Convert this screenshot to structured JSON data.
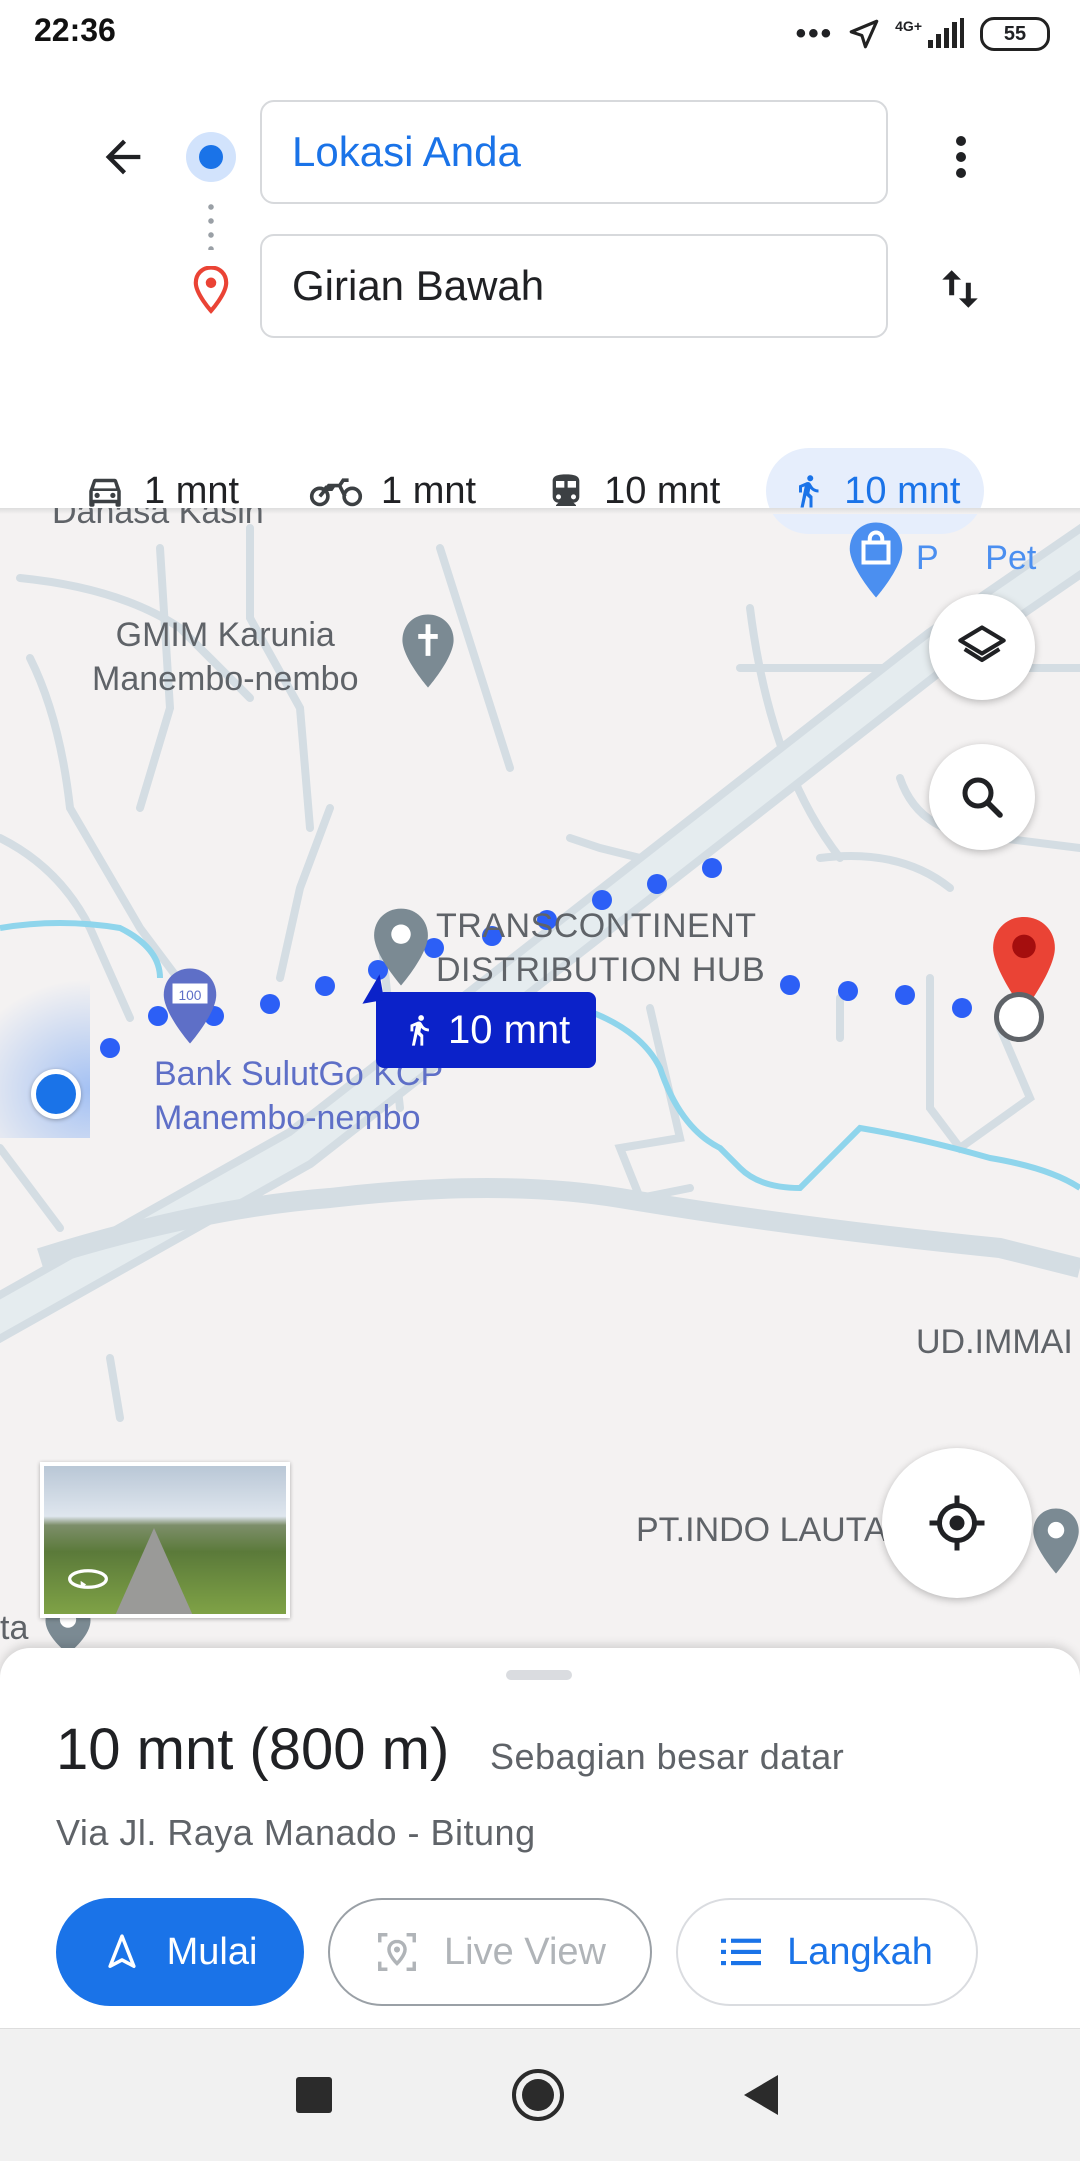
{
  "status_bar": {
    "time": "22:36",
    "network": "4G+",
    "battery": "55"
  },
  "directions": {
    "origin": "Lokasi Anda",
    "destination": "Girian Bawah",
    "modes": [
      {
        "icon": "car-icon",
        "label": "1 mnt"
      },
      {
        "icon": "motorcycle-icon",
        "label": "1 mnt"
      },
      {
        "icon": "transit-icon",
        "label": "10 mnt"
      },
      {
        "icon": "walk-icon",
        "label": "10 mnt",
        "active": true
      }
    ]
  },
  "map": {
    "labels": {
      "top_cut": "Dahasa Kasih",
      "church": "GMIM Karunia\nManembo-nembo",
      "shop": "P     Pet",
      "hub": "TRANSCONTINENT\nDISTRIBUTION HUB",
      "bank": "Bank SulutGo KCP\nManembo-nembo",
      "ud": "UD.IMMAI",
      "pt": "PT.INDO LAUTA",
      "left_cut": "ta"
    },
    "route_badge": "10 mnt",
    "route_color": "#2c5ff6",
    "badge_color": "#0b22c9"
  },
  "sheet": {
    "summary": "10 mnt (800 m)",
    "terrain": "Sebagian besar datar",
    "via": "Via Jl. Raya Manado - Bitung",
    "start_label": "Mulai",
    "liveview_label": "Live View",
    "steps_label": "Langkah"
  },
  "colors": {
    "accent": "#1a73e8",
    "destination_pin": "#ea4335"
  }
}
